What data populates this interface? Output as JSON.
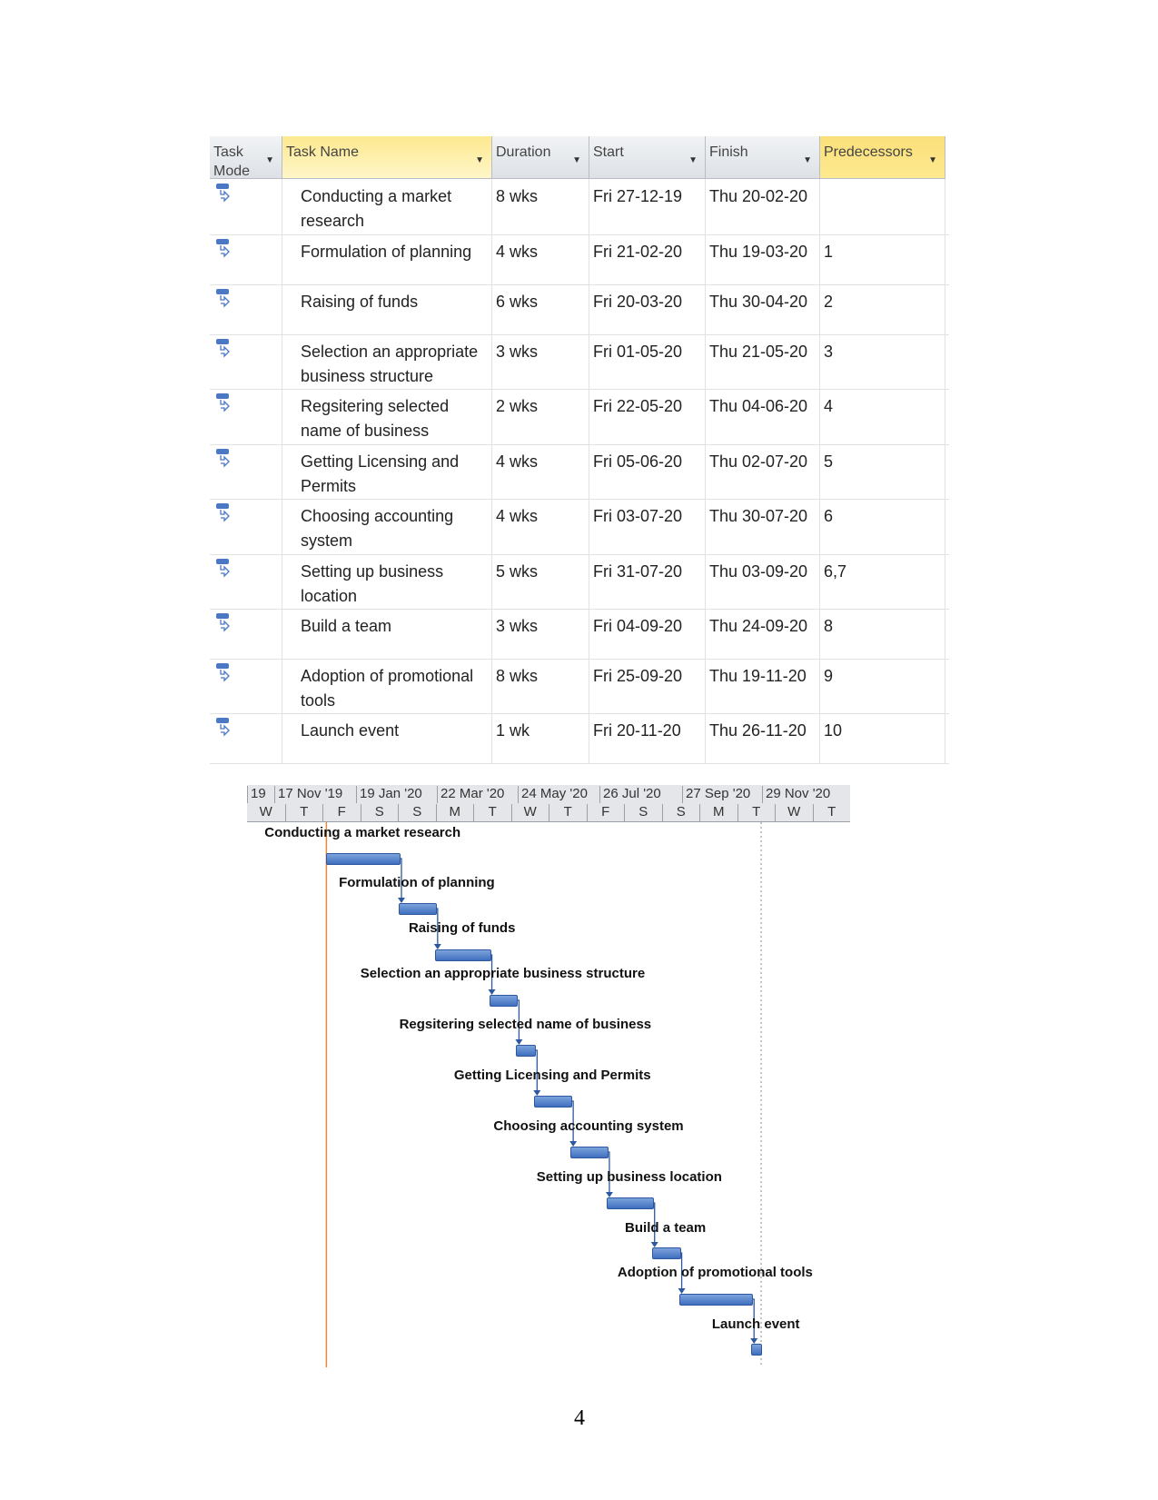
{
  "table": {
    "columns": [
      "Task Mode",
      "Task Name",
      "Duration",
      "Start",
      "Finish",
      "Predecessors"
    ],
    "rows": [
      {
        "name": "Conducting a market research",
        "duration": "8 wks",
        "start": "Fri 27-12-19",
        "finish": "Thu 20-02-20",
        "pred": ""
      },
      {
        "name": "Formulation of planning",
        "duration": "4 wks",
        "start": "Fri 21-02-20",
        "finish": "Thu 19-03-20",
        "pred": "1"
      },
      {
        "name": "Raising of funds",
        "duration": "6 wks",
        "start": "Fri 20-03-20",
        "finish": "Thu 30-04-20",
        "pred": "2"
      },
      {
        "name": "Selection an appropriate business structure",
        "duration": "3 wks",
        "start": "Fri 01-05-20",
        "finish": "Thu 21-05-20",
        "pred": "3"
      },
      {
        "name": "Regsitering selected name of business",
        "duration": "2 wks",
        "start": "Fri 22-05-20",
        "finish": "Thu 04-06-20",
        "pred": "4"
      },
      {
        "name": "Getting Licensing and Permits",
        "duration": "4 wks",
        "start": "Fri 05-06-20",
        "finish": "Thu 02-07-20",
        "pred": "5"
      },
      {
        "name": "Choosing accounting system",
        "duration": "4 wks",
        "start": "Fri 03-07-20",
        "finish": "Thu 30-07-20",
        "pred": "6"
      },
      {
        "name": "Setting up business location",
        "duration": "5 wks",
        "start": "Fri 31-07-20",
        "finish": "Thu 03-09-20",
        "pred": "6,7"
      },
      {
        "name": "Build a team",
        "duration": "3 wks",
        "start": "Fri 04-09-20",
        "finish": "Thu 24-09-20",
        "pred": "8"
      },
      {
        "name": "Adoption of promotional tools",
        "duration": "8 wks",
        "start": "Fri 25-09-20",
        "finish": "Thu 19-11-20",
        "pred": "9"
      },
      {
        "name": "Launch event",
        "duration": "1 wk",
        "start": "Fri 20-11-20",
        "finish": "Thu 26-11-20",
        "pred": "10"
      }
    ]
  },
  "gantt": {
    "timescale_top": [
      "19",
      "17 Nov '19",
      "19 Jan '20",
      "22 Mar '20",
      "24 May '20",
      "26 Jul '20",
      "27 Sep '20",
      "29 Nov '20"
    ],
    "timescale_bottom": [
      "W",
      "T",
      "F",
      "S",
      "S",
      "M",
      "T",
      "W",
      "T",
      "F",
      "S",
      "S",
      "M",
      "T",
      "W",
      "T"
    ],
    "bar_color": "#4a78c4",
    "project_start_line_color": "#e8883a",
    "tasks": [
      {
        "label": "Conducting a market research",
        "start": "2019-12-27",
        "finish": "2020-02-20"
      },
      {
        "label": "Formulation of planning",
        "start": "2020-02-21",
        "finish": "2020-03-19"
      },
      {
        "label": "Raising of funds",
        "start": "2020-03-20",
        "finish": "2020-04-30"
      },
      {
        "label": "Selection an appropriate business structure",
        "start": "2020-05-01",
        "finish": "2020-05-21"
      },
      {
        "label": "Regsitering selected name of business",
        "start": "2020-05-22",
        "finish": "2020-06-04"
      },
      {
        "label": "Getting Licensing and Permits",
        "start": "2020-06-05",
        "finish": "2020-07-02"
      },
      {
        "label": "Choosing accounting system",
        "start": "2020-07-03",
        "finish": "2020-07-30"
      },
      {
        "label": "Setting up business location",
        "start": "2020-07-31",
        "finish": "2020-09-03"
      },
      {
        "label": "Build a team",
        "start": "2020-09-04",
        "finish": "2020-09-24"
      },
      {
        "label": "Adoption of promotional tools",
        "start": "2020-09-25",
        "finish": "2020-11-19"
      },
      {
        "label": "Launch event",
        "start": "2020-11-20",
        "finish": "2020-11-26"
      }
    ]
  },
  "page_number": "4"
}
